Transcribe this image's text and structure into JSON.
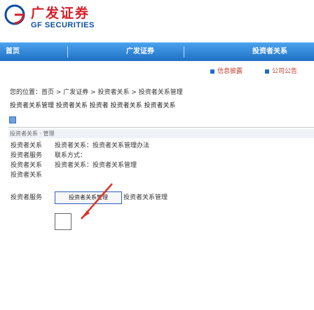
{
  "header": {
    "logo_cn": "广发证券",
    "logo_en": "GF SECURITIES"
  },
  "navbar": {
    "items": [
      "首页",
      "广发证券",
      "投资者关系"
    ]
  },
  "tabs": [
    "信息披露",
    "公司公告"
  ],
  "breadcrumb": "您的位置：首页 > 广发证券 > 投资者关系 > 投资者关系管理",
  "notice": "投资者关系管理 投资者关系 投资者 投资者关系 投资者关系",
  "section": {
    "title": "投资者关系 · 管理"
  },
  "left_items": [
    "投资者关系",
    "投资者服务",
    "投资者关系",
    "投资者关系",
    "投资者服务"
  ],
  "right_lines": [
    "投资者关系：投资者关系管理办法",
    "联系方式：",
    "投资者关系：投资者关系管理"
  ],
  "highlight": {
    "button_label": "投资者关系管理",
    "text": "投资者关系管理"
  },
  "colors": {
    "nav_top": "#4aa3ee",
    "nav_bottom": "#1f6fc3",
    "logo_red": "#d4202a",
    "logo_blue": "#0b4ea2",
    "annotation_red": "#e0302a"
  },
  "icons": {
    "logo": "gf-logo-icon",
    "tab_marker": "square-icon",
    "section": "page-icon"
  }
}
